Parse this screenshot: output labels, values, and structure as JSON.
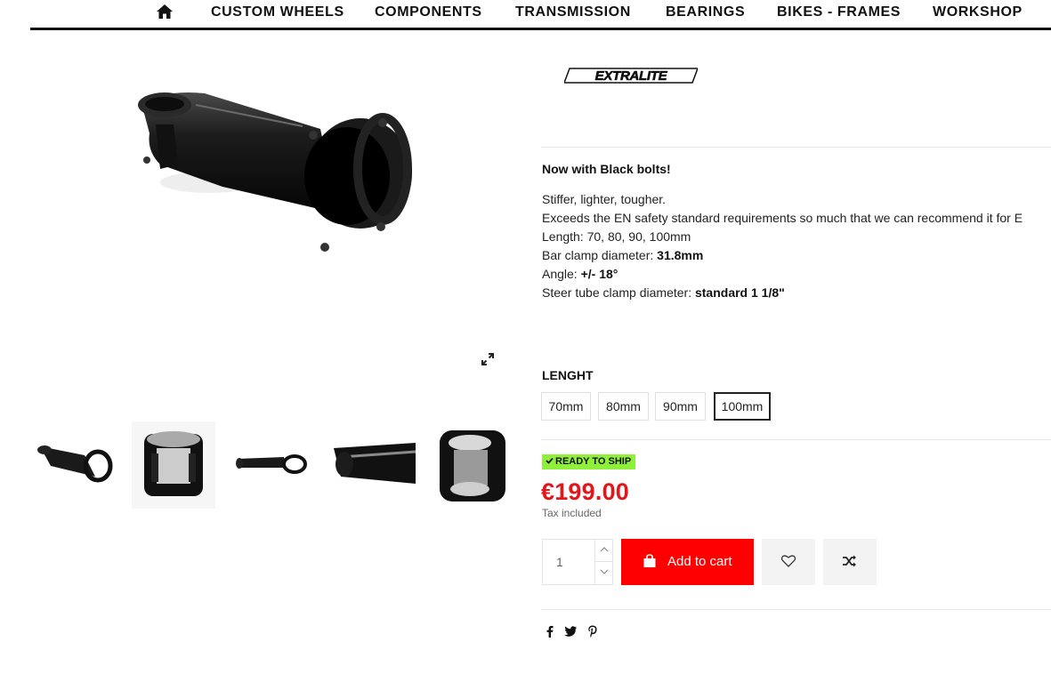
{
  "nav": {
    "home_icon": "home-icon",
    "items": [
      "CUSTOM WHEELS",
      "COMPONENTS",
      "TRANSMISSION",
      "BEARINGS",
      "BIKES - FRAMES",
      "WORKSHOP"
    ]
  },
  "gallery": {
    "main_image": "stem-product-image",
    "expand_icon": "expand-icon",
    "thumbnails": [
      "stem-thumb-1",
      "stem-thumb-2",
      "stem-thumb-3",
      "stem-thumb-4",
      "stem-thumb-5"
    ]
  },
  "brand": {
    "logo_text": "EXTRALITE"
  },
  "description": {
    "title": "Now with Black bolts!",
    "line1": "Stiffer, lighter, tougher.",
    "line2": "Exceeds the EN safety standard requirements so much that we can recommend it for E",
    "line3": "Length: 70, 80, 90, 100mm",
    "line4_label": "Bar clamp diameter: ",
    "line4_value": "31.8mm",
    "line5_label": "Angle: ",
    "line5_value": "+/- 18°",
    "line6_label": "Steer tube clamp diameter: ",
    "line6_value": "standard 1 1/8\""
  },
  "variant": {
    "title": "LENGHT",
    "options": [
      "70mm",
      "80mm",
      "90mm",
      "100mm"
    ],
    "selected": "100mm"
  },
  "availability": {
    "label": "READY TO SHIP",
    "color": "#8ef03a"
  },
  "price": {
    "value": "€199.00",
    "tax_note": "Tax included",
    "color": "#e0171b"
  },
  "cart": {
    "quantity": "1",
    "add_label": "Add to cart",
    "button_color": "#ff0000",
    "wishlist_icon": "heart-icon",
    "compare_icon": "shuffle-icon"
  },
  "share": [
    "facebook-icon",
    "twitter-icon",
    "pinterest-icon"
  ]
}
